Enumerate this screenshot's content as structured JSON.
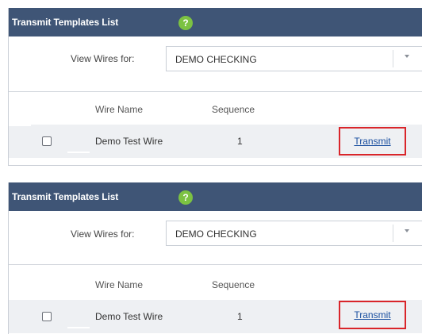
{
  "panels": [
    {
      "title": "Transmit Templates List",
      "help_icon": "?",
      "filter_label": "View Wires for:",
      "account_select": "DEMO CHECKING",
      "columns": {
        "wire_name": "Wire Name",
        "sequence": "Sequence"
      },
      "rows": [
        {
          "wire_name": "Demo Test Wire",
          "sequence": "1",
          "action": "Transmit"
        }
      ]
    },
    {
      "title": "Transmit Templates List",
      "help_icon": "?",
      "filter_label": "View Wires for:",
      "account_select": "DEMO CHECKING",
      "columns": {
        "wire_name": "Wire Name",
        "sequence": "Sequence"
      },
      "rows": [
        {
          "wire_name": "Demo Test Wire",
          "sequence": "1",
          "action": "Transmit"
        }
      ]
    }
  ],
  "colors": {
    "header_bg": "#3f5576",
    "help_icon_bg": "#7cc242",
    "highlight_border": "#d9252a",
    "link": "#1a4fa0",
    "row_bg": "#eef0f3"
  },
  "icons": {
    "help": "question-circle-icon",
    "dropdown": "chevron-down-icon"
  }
}
